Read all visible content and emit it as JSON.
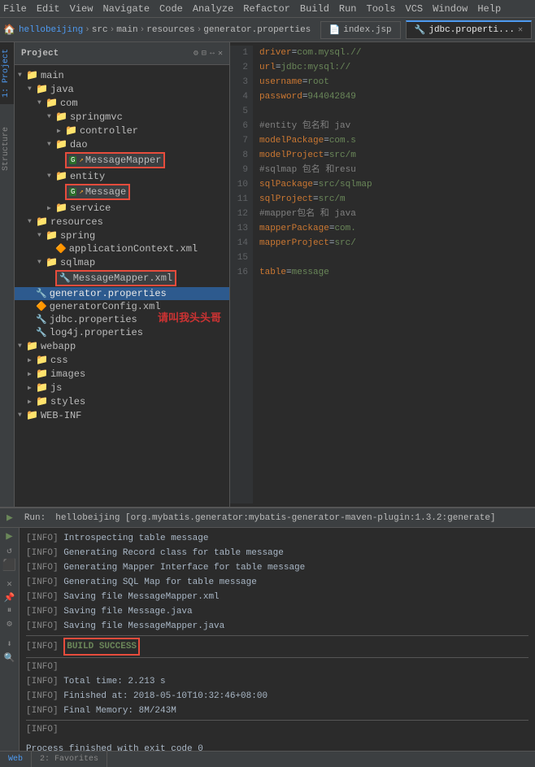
{
  "menubar": {
    "items": [
      "File",
      "Edit",
      "View",
      "Navigate",
      "Code",
      "Analyze",
      "Refactor",
      "Build",
      "Run",
      "Tools",
      "VCS",
      "Window",
      "Help"
    ]
  },
  "topbar": {
    "project_icon": "🏠",
    "project_name": "hellobeijing",
    "src": "src",
    "main": "main",
    "resources": "resources",
    "file": "generator.properties",
    "tabs": [
      {
        "label": "index.jsp",
        "icon": "📄",
        "active": false
      },
      {
        "label": "jdbc.properti...",
        "icon": "🔧",
        "active": true
      }
    ]
  },
  "project_panel": {
    "title": "Project",
    "tree": [
      {
        "level": 0,
        "type": "folder",
        "label": "main",
        "expanded": true
      },
      {
        "level": 1,
        "type": "folder",
        "label": "java",
        "expanded": true
      },
      {
        "level": 2,
        "type": "folder",
        "label": "com",
        "expanded": true
      },
      {
        "level": 3,
        "type": "folder",
        "label": "springmvc",
        "expanded": true
      },
      {
        "level": 4,
        "type": "folder",
        "label": "controller",
        "expanded": false
      },
      {
        "level": 3,
        "type": "folder",
        "label": "dao",
        "expanded": true,
        "red_border": true
      },
      {
        "level": 4,
        "type": "mapper",
        "label": "MessageMapper",
        "red_border": true
      },
      {
        "level": 3,
        "type": "folder",
        "label": "entity",
        "expanded": true
      },
      {
        "level": 4,
        "type": "entity",
        "label": "Message",
        "red_border": true
      },
      {
        "level": 3,
        "type": "folder",
        "label": "service",
        "expanded": false
      },
      {
        "level": 1,
        "type": "folder",
        "label": "resources",
        "expanded": true
      },
      {
        "level": 2,
        "type": "folder",
        "label": "spring",
        "expanded": true
      },
      {
        "level": 3,
        "type": "xml",
        "label": "applicationContext.xml"
      },
      {
        "level": 2,
        "type": "folder",
        "label": "sqlmap",
        "expanded": true
      },
      {
        "level": 3,
        "type": "xml-mapper",
        "label": "MessageMapper.xml",
        "red_border": true
      },
      {
        "level": 1,
        "type": "properties",
        "label": "generator.properties",
        "selected": true
      },
      {
        "level": 1,
        "type": "xml",
        "label": "generatorConfig.xml"
      },
      {
        "level": 1,
        "type": "properties",
        "label": "jdbc.properties"
      },
      {
        "level": 1,
        "type": "properties",
        "label": "log4j.properties"
      },
      {
        "level": 0,
        "type": "folder",
        "label": "webapp",
        "expanded": true
      },
      {
        "level": 1,
        "type": "folder",
        "label": "css",
        "expanded": false
      },
      {
        "level": 1,
        "type": "folder",
        "label": "images",
        "expanded": false
      },
      {
        "level": 1,
        "type": "folder",
        "label": "js",
        "expanded": false
      },
      {
        "level": 1,
        "type": "folder",
        "label": "styles",
        "expanded": false
      },
      {
        "level": 0,
        "type": "folder",
        "label": "WEB-INF",
        "expanded": true
      }
    ],
    "chinese_watermark": "请叫我头头哥"
  },
  "editor": {
    "filename": "jdbc.properties",
    "lines": [
      {
        "num": 1,
        "content": "driver=com.mysql.//"
      },
      {
        "num": 2,
        "content": "url=jdbc:mysql://"
      },
      {
        "num": 3,
        "content": "username=root"
      },
      {
        "num": 4,
        "content": "password=944042849"
      },
      {
        "num": 5,
        "content": ""
      },
      {
        "num": 6,
        "content": "#entity 包名和 jav"
      },
      {
        "num": 7,
        "content": "modelPackage=com.s"
      },
      {
        "num": 8,
        "content": "modelProject=src/m"
      },
      {
        "num": 9,
        "content": "#sqlmap 包名 和resu"
      },
      {
        "num": 10,
        "content": "sqlPackage=src/sqlmap"
      },
      {
        "num": 11,
        "content": "sqlProject=src/m"
      },
      {
        "num": 12,
        "content": "#mapper包名 和 java"
      },
      {
        "num": 13,
        "content": "mapperPackage=com."
      },
      {
        "num": 14,
        "content": "mapperProject=src/"
      },
      {
        "num": 15,
        "content": ""
      },
      {
        "num": 16,
        "content": "table=message"
      }
    ]
  },
  "run_panel": {
    "title": "Run",
    "command": "hellobeijing [org.mybatis.generator:mybatis-generator-maven-plugin:1.3.2:generate]",
    "logs": [
      "[INFO] Introspecting table message",
      "[INFO] Generating Record class for table message",
      "[INFO] Generating Mapper Interface for table message",
      "[INFO] Generating SQL Map for table message",
      "[INFO] Saving file MessageMapper.xml",
      "[INFO] Saving file Message.java",
      "[INFO] Saving file MessageMapper.java",
      "[INFO] ————————————————————",
      "[INFO] BUILD SUCCESS",
      "[INFO] ————————————————————",
      "[INFO] Total time: 2.213 s",
      "[INFO] Finished at: 2018-05-10T10:32:46+08:00",
      "[INFO] Final Memory: 8M/243M",
      "[INFO] ————————————————————"
    ],
    "footer": "Process finished with exit code 0",
    "build_success_index": 8
  },
  "bottom_tabs": [
    {
      "label": "Web",
      "active": true
    },
    {
      "label": "2: Favorites",
      "active": false
    }
  ],
  "side_panel_tabs": [
    {
      "label": "1: Project"
    },
    {
      "label": "Structure"
    }
  ]
}
